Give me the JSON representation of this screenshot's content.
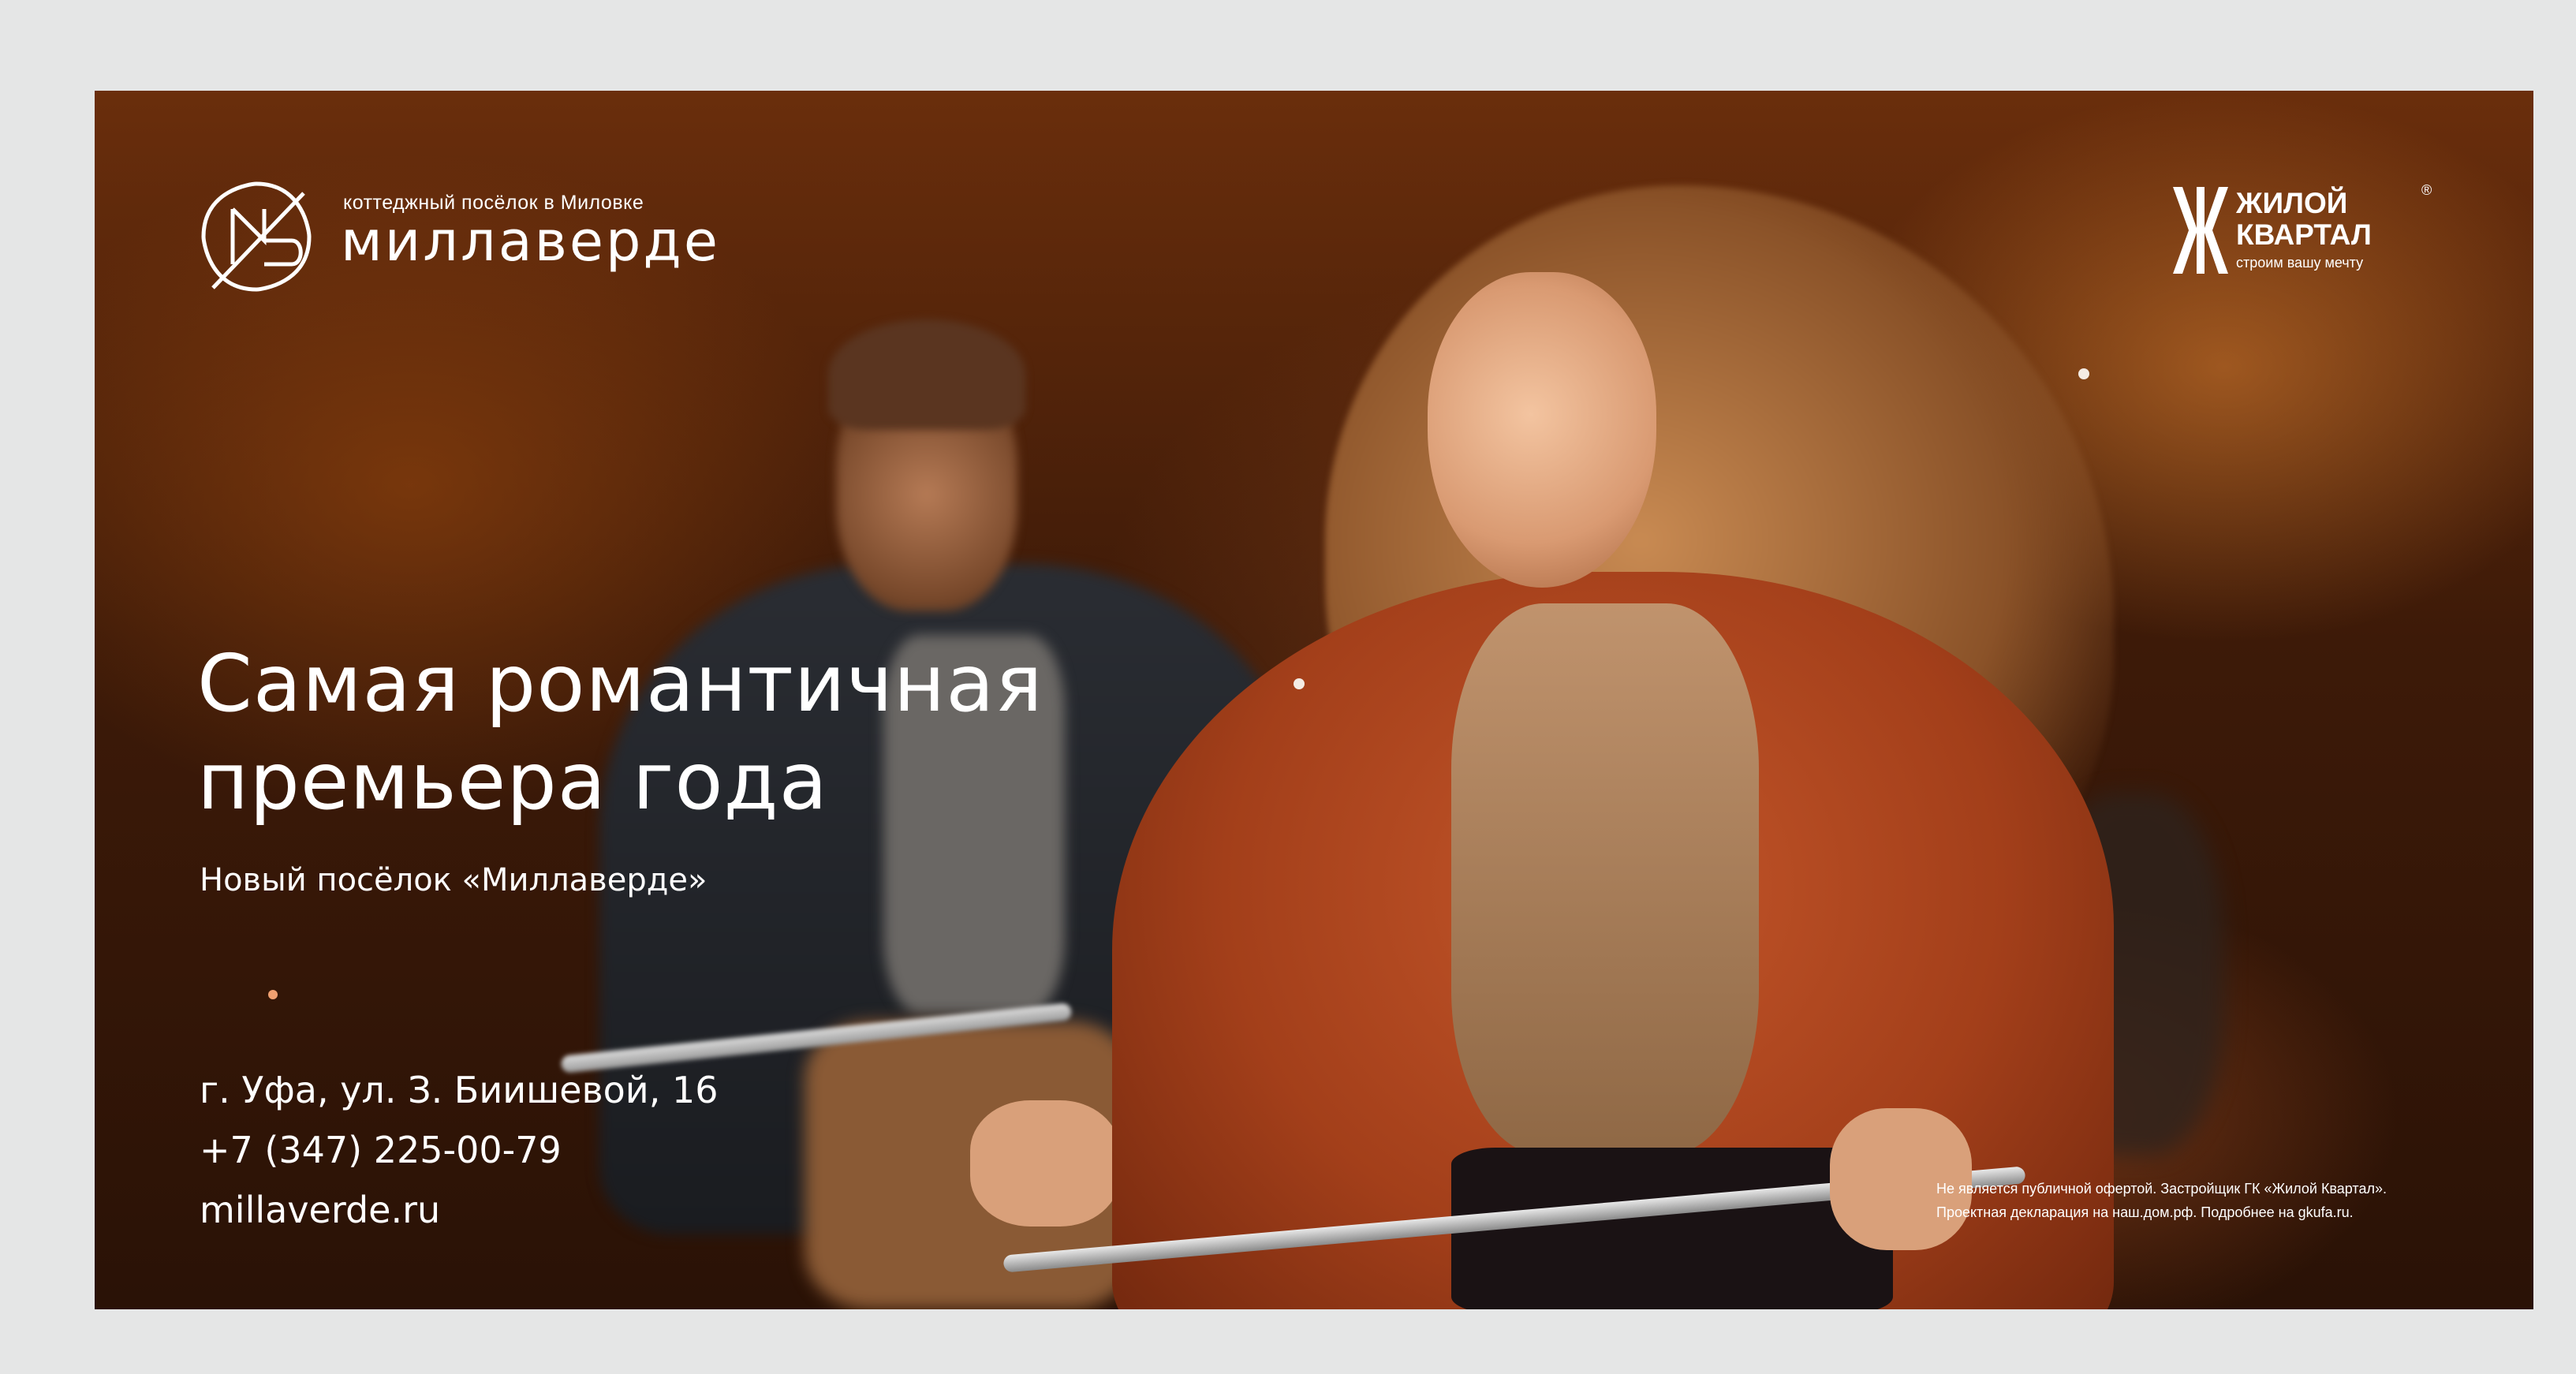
{
  "brand": {
    "tagline": "коттеджный посёлок в Миловке",
    "name": "миллаверде"
  },
  "partner": {
    "line1": "ЖИЛОЙ",
    "line2": "КВАРТАЛ",
    "slogan": "строим вашу мечту",
    "registered": "®"
  },
  "headline": {
    "line1": "Самая романтичная",
    "line2": "премьера года"
  },
  "subheadline": "Новый посёлок «Миллаверде»",
  "contacts": {
    "address": "г. Уфа, ул. З. Биишевой, 16",
    "phone": "+7 (347) 225-00-79",
    "website": "millaverde.ru"
  },
  "disclaimer": {
    "line1": "Не является публичной офертой. Застройщик ГК «Жилой Квартал».",
    "line2": "Проектная декларация на наш.дом.рф. Подробнее на gkufa.ru."
  },
  "colors": {
    "frame": "#e5e6e6",
    "text": "#ffffff",
    "accent_sweater": "#a33f1a"
  }
}
